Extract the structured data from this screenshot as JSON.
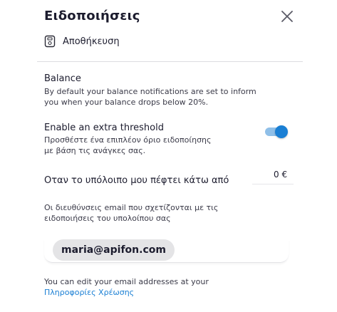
{
  "dialog": {
    "title": "Ειδοποιήσεις",
    "close_icon": "close-icon",
    "save_label": "Αποθήκευση",
    "save_icon": "save-icon"
  },
  "balance": {
    "title": "Balance",
    "description": "By default your balance notifications are set to inform you when your balance drops below 20%."
  },
  "threshold": {
    "title": "Enable an extra threshold",
    "description": "Προσθέστε ένα επιπλέον όριο ειδοποίησης με βάση τις ανάγκες σας.",
    "enabled": true
  },
  "limit": {
    "label": "Οταν το υπόλοιπο μου πέφτει κάτω από",
    "value": "0 €"
  },
  "emails": {
    "description": "Οι διευθύνσεις email που σχετίζονται με τις ειδοποιήσεις του υπολοίπου σας",
    "items": [
      "maria@apifon.com"
    ]
  },
  "footer": {
    "text": "You can edit your email addresses at your",
    "link": "Πληροφορίες Χρέωσης"
  },
  "colors": {
    "accent": "#1a7fd4",
    "toggle_track": "#8fbfe8",
    "chip_bg": "#e4e4e6"
  }
}
